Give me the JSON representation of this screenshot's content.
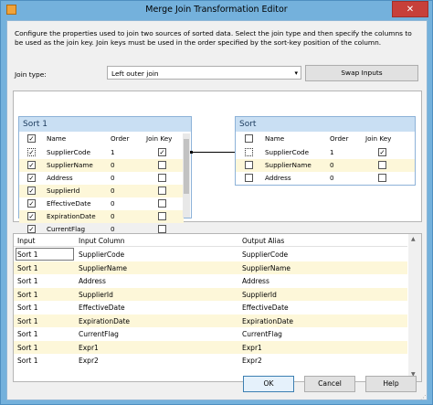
{
  "window": {
    "title": "Merge Join Transformation Editor",
    "close_glyph": "✕"
  },
  "description": "Configure the properties used to join two sources of sorted data. Select the join type and then specify the columns to be used as the join key. Join keys must be used in the order specified by the sort-key position of the column.",
  "join": {
    "label": "Join type:",
    "value": "Left outer join",
    "swap_label": "Swap Inputs"
  },
  "left_table": {
    "title": "Sort 1",
    "headers": {
      "name": "Name",
      "order": "Order",
      "join_key": "Join Key"
    },
    "rows": [
      {
        "name": "SupplierCode",
        "order": "1",
        "checked": true,
        "join_key": true
      },
      {
        "name": "SupplierName",
        "order": "0",
        "checked": true,
        "join_key": false
      },
      {
        "name": "Address",
        "order": "0",
        "checked": true,
        "join_key": false
      },
      {
        "name": "SupplierId",
        "order": "0",
        "checked": true,
        "join_key": false
      },
      {
        "name": "EffectiveDate",
        "order": "0",
        "checked": true,
        "join_key": false
      },
      {
        "name": "ExpirationDate",
        "order": "0",
        "checked": true,
        "join_key": false
      },
      {
        "name": "CurrentFlag",
        "order": "0",
        "checked": true,
        "join_key": false
      }
    ]
  },
  "right_table": {
    "title": "Sort",
    "headers": {
      "name": "Name",
      "order": "Order",
      "join_key": "Join Key"
    },
    "rows": [
      {
        "name": "SupplierCode",
        "order": "1",
        "checked": false,
        "join_key": true
      },
      {
        "name": "SupplierName",
        "order": "0",
        "checked": false,
        "join_key": false
      },
      {
        "name": "Address",
        "order": "0",
        "checked": false,
        "join_key": false
      }
    ]
  },
  "mapping": {
    "headers": {
      "input": "Input",
      "input_column": "Input Column",
      "output_alias": "Output Alias"
    },
    "rows": [
      {
        "input": "Sort 1",
        "input_column": "SupplierCode",
        "output_alias": "SupplierCode"
      },
      {
        "input": "Sort 1",
        "input_column": "SupplierName",
        "output_alias": "SupplierName"
      },
      {
        "input": "Sort 1",
        "input_column": "Address",
        "output_alias": "Address"
      },
      {
        "input": "Sort 1",
        "input_column": "SupplierId",
        "output_alias": "SupplierId"
      },
      {
        "input": "Sort 1",
        "input_column": "EffectiveDate",
        "output_alias": "EffectiveDate"
      },
      {
        "input": "Sort 1",
        "input_column": "ExpirationDate",
        "output_alias": "ExpirationDate"
      },
      {
        "input": "Sort 1",
        "input_column": "CurrentFlag",
        "output_alias": "CurrentFlag"
      },
      {
        "input": "Sort 1",
        "input_column": "Expr1",
        "output_alias": "Expr1"
      },
      {
        "input": "Sort 1",
        "input_column": "Expr2",
        "output_alias": "Expr2"
      }
    ]
  },
  "buttons": {
    "ok": "OK",
    "cancel": "Cancel",
    "help": "Help"
  },
  "colors": {
    "highlight_row": "#fdf7d9",
    "title_bar": "#74b1dc",
    "table_header": "#c9dff3"
  }
}
